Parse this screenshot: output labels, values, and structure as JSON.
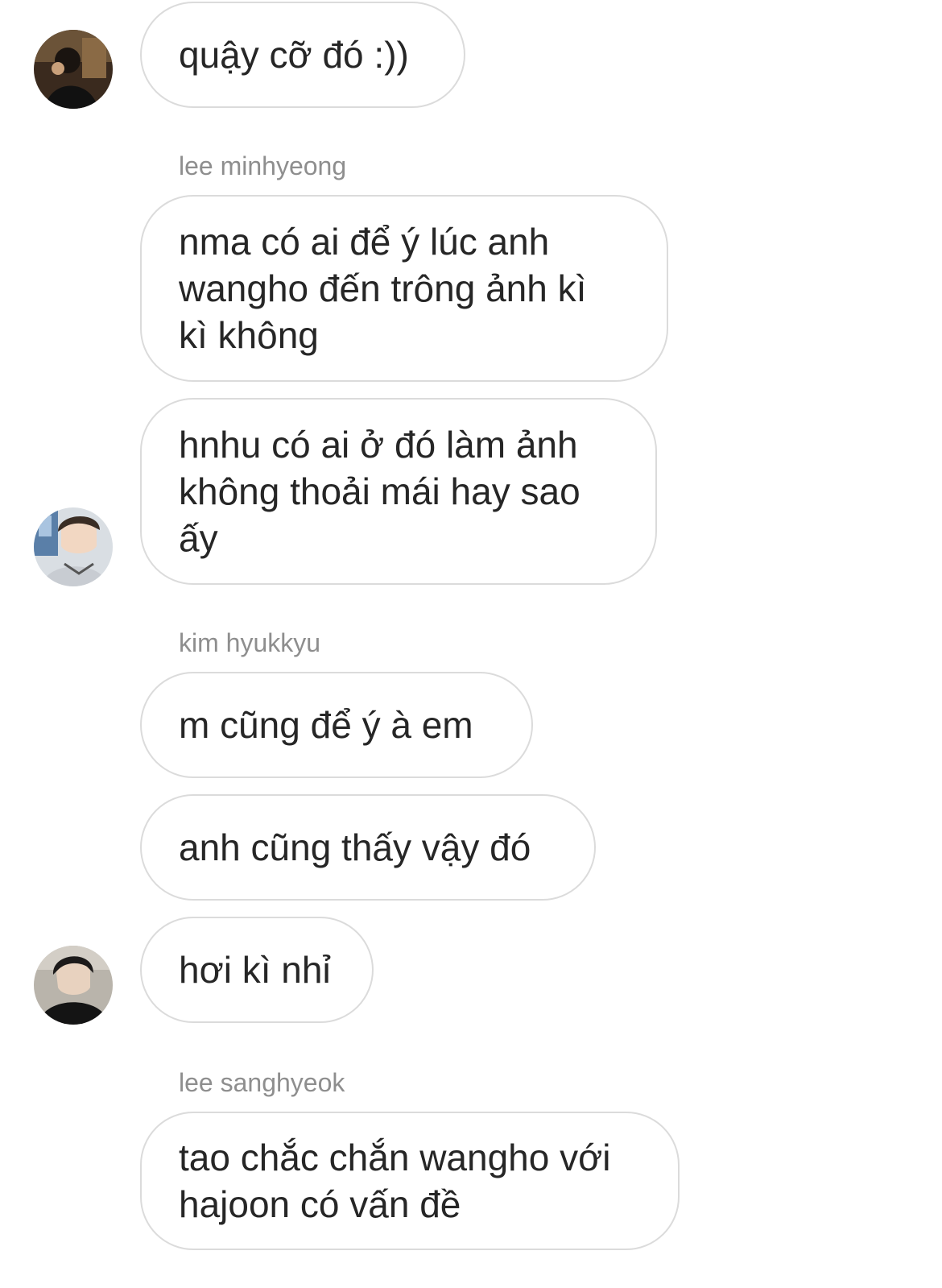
{
  "thread": {
    "groups": [
      {
        "sender": "",
        "avatar": "avatar-user-1",
        "messages": [
          "quậy cỡ đó :))"
        ]
      },
      {
        "sender": "lee minhyeong",
        "avatar": "avatar-lee-minhyeong",
        "messages": [
          "nma có ai để ý lúc anh\nwangho đến trông ảnh kì\nkì không",
          "hnhu có ai ở đó làm ảnh\nkhông thoải mái hay sao\nấy"
        ]
      },
      {
        "sender": "kim hyukkyu",
        "avatar": "avatar-kim-hyukkyu",
        "messages": [
          "m cũng để ý à em",
          "anh cũng thấy vậy đó",
          "hơi kì nhỉ"
        ]
      },
      {
        "sender": "lee sanghyeok",
        "avatar": "",
        "messages": [
          "tao chắc chắn wangho với\nhajoon có vấn đề"
        ]
      }
    ]
  }
}
